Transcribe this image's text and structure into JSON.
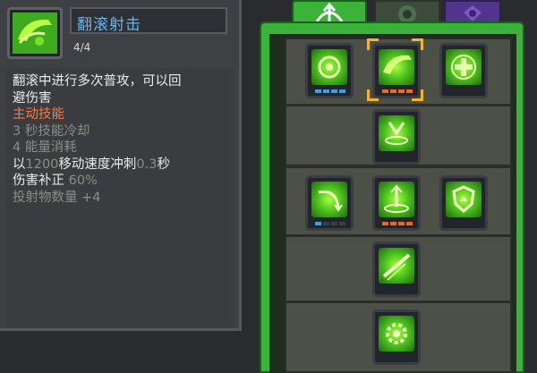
{
  "tooltip": {
    "title": "翻滚射击",
    "level": "4/4",
    "lines": [
      {
        "text": "翻滚中进行多次普攻，可以回",
        "kind": "desc"
      },
      {
        "text": "避伤害",
        "kind": "desc"
      },
      {
        "text": "主动技能",
        "kind": "active"
      },
      {
        "text": "3 秒技能冷却",
        "kind": "stat"
      },
      {
        "text": "4 能量消耗",
        "kind": "stat"
      }
    ],
    "dash_line": {
      "prefix": "以",
      "speed": "1200",
      "middle": "移动速度冲刺",
      "seconds": "0.3",
      "suffix": "秒"
    },
    "damage_line": {
      "label": "伤害补正 ",
      "value": "60%"
    },
    "projectile_line": {
      "label": "投射物数量 ",
      "value": "+4"
    }
  },
  "tabs": [
    {
      "name": "archer-tab",
      "icon": "bow-arrow-icon",
      "active": true
    },
    {
      "name": "nature-tab",
      "icon": "leaf-circle-icon",
      "active": false
    },
    {
      "name": "shadow-tab",
      "icon": "purple-sigil-icon",
      "active": false
    }
  ],
  "skills": [
    {
      "id": "target-circle-skill",
      "icon": "target-circle-icon",
      "pips": [
        "blue",
        "blue",
        "blue",
        "blue"
      ]
    },
    {
      "id": "roll-shot-skill",
      "icon": "roll-shot-icon",
      "pips": [
        "orange",
        "orange",
        "orange",
        "orange"
      ],
      "selected": true
    },
    {
      "id": "heal-cross-skill",
      "icon": "heal-cross-icon",
      "pips": []
    },
    {
      "id": "arrow-rain-skill",
      "icon": "arrow-rain-icon",
      "pips": []
    },
    {
      "id": "swirl-arrow-skill",
      "icon": "swirl-arrow-icon",
      "pips": [
        "blue",
        "dim",
        "dim",
        "dim"
      ]
    },
    {
      "id": "trap-skill",
      "icon": "trap-icon",
      "pips": [
        "orange",
        "orange",
        "orange",
        "orange"
      ]
    },
    {
      "id": "shield-skill",
      "icon": "shield-icon",
      "pips": []
    },
    {
      "id": "piercing-shot-skill",
      "icon": "piercing-shot-icon",
      "pips": []
    },
    {
      "id": "gear-burst-skill",
      "icon": "gear-burst-icon",
      "pips": []
    }
  ],
  "colors": {
    "accent_green": "#3bb23a",
    "title_blue": "#63b8f0",
    "active_orange": "#ff7a3c",
    "pip_blue": "#3aa0e8",
    "pip_orange": "#ea6a26",
    "selection_gold": "#f0b52a"
  }
}
